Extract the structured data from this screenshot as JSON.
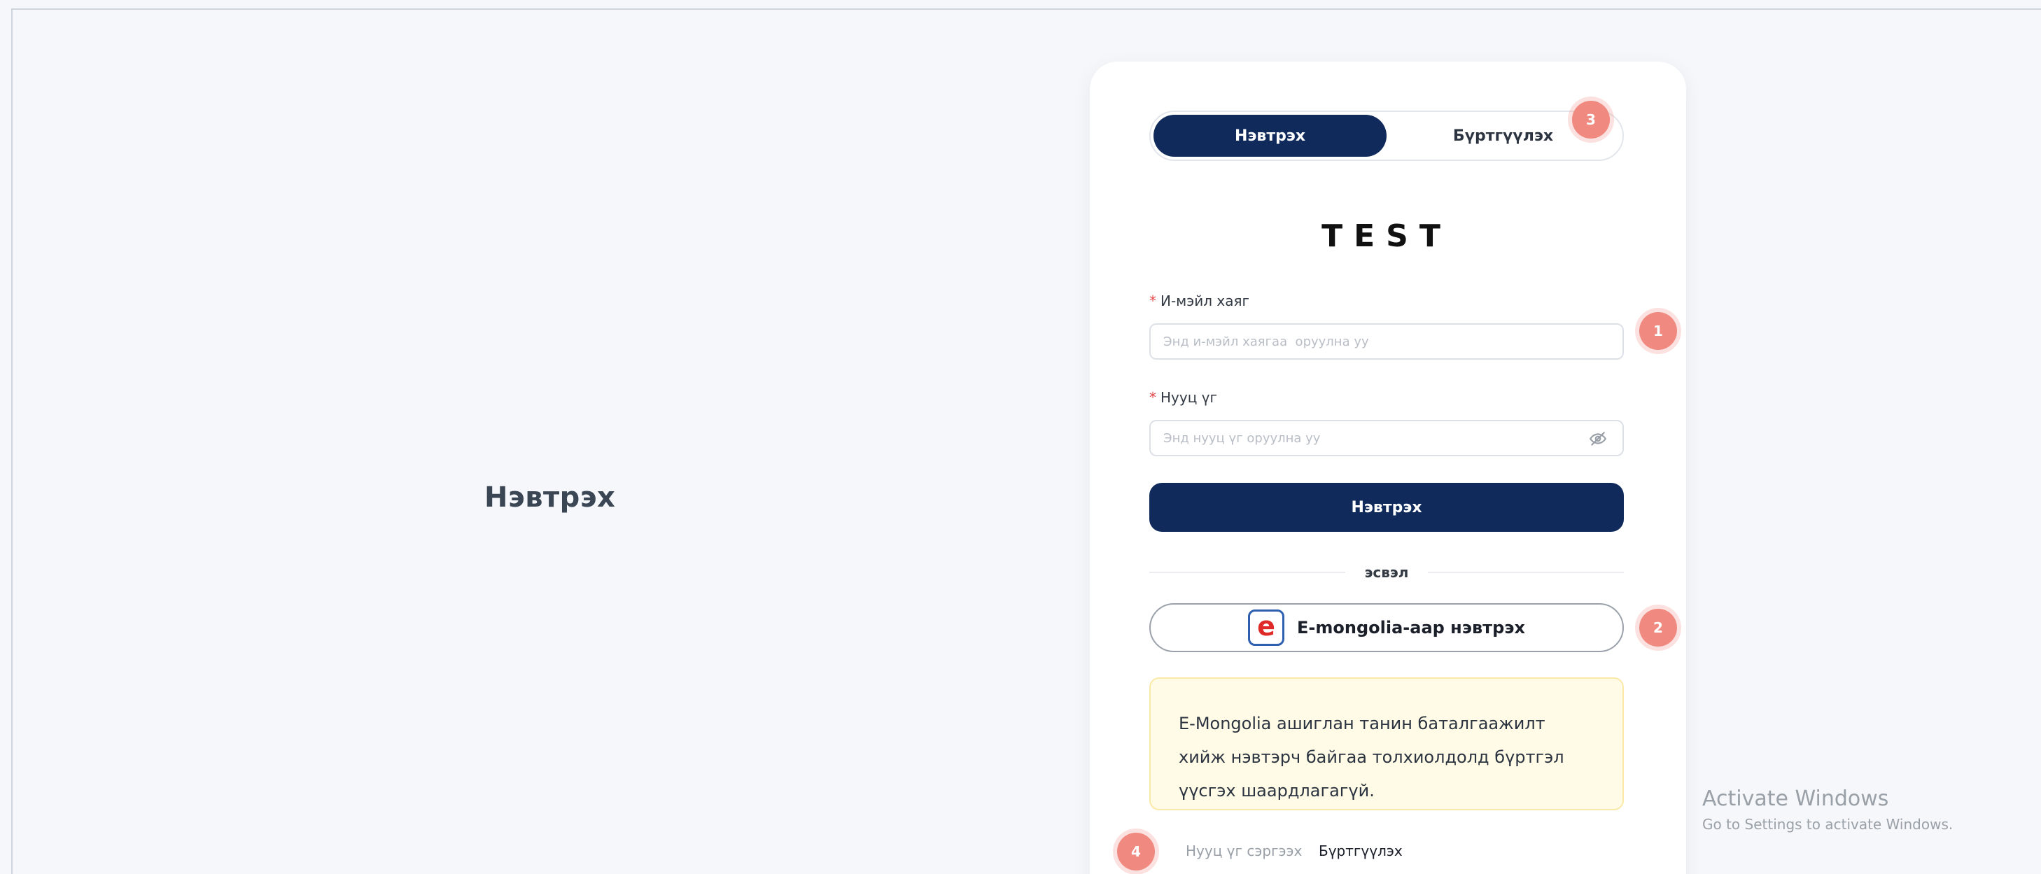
{
  "page": {
    "left_title": "Нэвтрэх"
  },
  "tabs": [
    {
      "label": "Нэвтрэх",
      "active": true
    },
    {
      "label": "Бүртгүүлэх",
      "active": false
    }
  ],
  "brand": "TEST",
  "email": {
    "label": "И-мэйл хаяг",
    "required_mark": "*",
    "placeholder": "Энд и-мэйл хаягаа  оруулна уу",
    "value": ""
  },
  "password": {
    "label": "Нууц үг",
    "required_mark": "*",
    "placeholder": "Энд нууц үг оруулна уу",
    "value": "",
    "toggle_icon": "eye-off-icon"
  },
  "login_button": "Нэвтрэх",
  "divider_text": "эсвэл",
  "emongolia": {
    "logo_letter": "e",
    "label": "E-mongolia-аар нэвтрэх"
  },
  "info_text": "E-Mongolia ашиглан танин баталгаажилт хийж нэвтэрч байгаа толхиолдолд бүртгэл үүсгэх шаардлагагүй.",
  "footer": {
    "forgot_password": "Нууц үг сэргээх",
    "register": "Бүртгүүлэх"
  },
  "annotations": {
    "badge_email": "1",
    "badge_emongolia": "2",
    "badge_tabs": "3",
    "badge_forgot": "4"
  },
  "watermark": {
    "line1": "Activate Windows",
    "line2": "Go to Settings to activate Windows."
  },
  "colors": {
    "primary": "#102a5c",
    "badge": "#f0897f",
    "required": "#e24a4a",
    "info_bg": "#fffbe6"
  }
}
